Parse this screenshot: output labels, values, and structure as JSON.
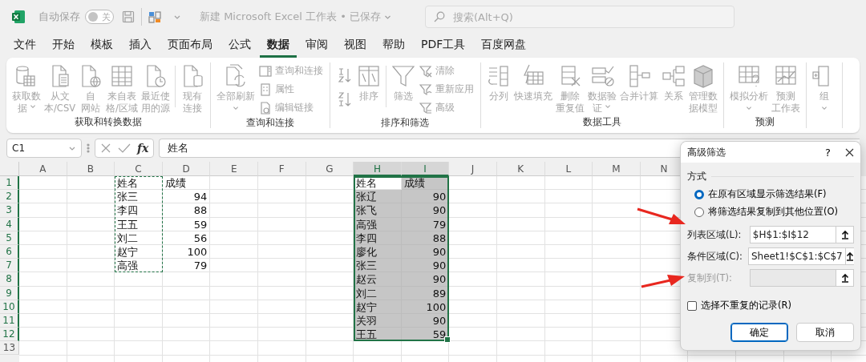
{
  "title_bar": {
    "autosave_label": "自动保存",
    "autosave": {
      "on": false,
      "label": "关"
    },
    "document_title": "新建 Microsoft Excel 工作表 • 已保存",
    "search_placeholder": "搜索(Alt+Q)"
  },
  "menu_tabs": [
    {
      "label": "文件",
      "selected": false
    },
    {
      "label": "开始",
      "selected": false
    },
    {
      "label": "模板",
      "selected": false
    },
    {
      "label": "插入",
      "selected": false
    },
    {
      "label": "页面布局",
      "selected": false
    },
    {
      "label": "公式",
      "selected": false
    },
    {
      "label": "数据",
      "selected": true
    },
    {
      "label": "审阅",
      "selected": false
    },
    {
      "label": "视图",
      "selected": false
    },
    {
      "label": "帮助",
      "selected": false
    },
    {
      "label": "PDF工具",
      "selected": false
    },
    {
      "label": "百度网盘",
      "selected": false
    }
  ],
  "ribbon": {
    "groups": [
      {
        "title": "获取和转换数据",
        "items": [
          {
            "kind": "large",
            "lines": [
              "获取数",
              "据"
            ],
            "dropdown": true
          },
          {
            "kind": "large",
            "lines": [
              "从文",
              "本/CSV"
            ],
            "dropdown": false
          },
          {
            "kind": "large",
            "lines": [
              "自",
              "网站"
            ],
            "dropdown": false
          },
          {
            "kind": "large",
            "lines": [
              "来自表",
              "格/区域"
            ],
            "dropdown": false
          },
          {
            "kind": "large",
            "lines": [
              "最近使",
              "用的源"
            ],
            "dropdown": false
          },
          {
            "kind": "separator"
          },
          {
            "kind": "large",
            "lines": [
              "现有",
              "连接"
            ],
            "dropdown": false
          }
        ]
      },
      {
        "title": "查询和连接",
        "items": [
          {
            "kind": "large",
            "lines": [
              "全部刷新"
            ],
            "dropdown": true
          },
          {
            "kind": "small_stack",
            "labels": [
              "查询和连接",
              "属性",
              "编辑链接"
            ]
          }
        ]
      },
      {
        "title": "排序和筛选",
        "items": [
          {
            "kind": "icon_stack"
          },
          {
            "kind": "large",
            "lines": [
              "排序"
            ],
            "dropdown": false
          },
          {
            "kind": "separator"
          },
          {
            "kind": "large",
            "lines": [
              "筛选"
            ],
            "dropdown": false
          },
          {
            "kind": "small_stack",
            "labels": [
              "清除",
              "重新应用",
              "高级"
            ]
          }
        ]
      },
      {
        "title": "数据工具",
        "items": [
          {
            "kind": "large",
            "lines": [
              "分列"
            ],
            "dropdown": false
          },
          {
            "kind": "large",
            "lines": [
              "快速填充"
            ],
            "dropdown": false
          },
          {
            "kind": "large",
            "lines": [
              "删除",
              "重复值"
            ],
            "dropdown": false
          },
          {
            "kind": "large",
            "lines": [
              "数据验",
              "证"
            ],
            "dropdown": true
          },
          {
            "kind": "large",
            "lines": [
              "合并计算"
            ],
            "dropdown": false
          },
          {
            "kind": "large",
            "lines": [
              "关系"
            ],
            "dropdown": false
          },
          {
            "kind": "large",
            "lines": [
              "管理数",
              "据模型"
            ],
            "dropdown": false
          }
        ]
      },
      {
        "title": "预测",
        "items": [
          {
            "kind": "large",
            "lines": [
              "模拟分析"
            ],
            "dropdown": true
          },
          {
            "kind": "large",
            "lines": [
              "预测",
              "工作表"
            ],
            "dropdown": false
          }
        ]
      },
      {
        "items": [
          {
            "kind": "large",
            "lines": [
              "组"
            ],
            "dropdown": true
          }
        ]
      }
    ]
  },
  "formula_bar": {
    "name_box": "C1",
    "function_label": "fx",
    "formula": "姓名"
  },
  "sheet": {
    "columns": [
      {
        "label": "A",
        "selected": false
      },
      {
        "label": "B",
        "selected": false
      },
      {
        "label": "C",
        "selected": false
      },
      {
        "label": "D",
        "selected": false
      },
      {
        "label": "E",
        "selected": false
      },
      {
        "label": "F",
        "selected": false
      },
      {
        "label": "G",
        "selected": false
      },
      {
        "label": "H",
        "selected": true
      },
      {
        "label": "I",
        "selected": true
      },
      {
        "label": "J",
        "selected": false
      },
      {
        "label": "K",
        "selected": false
      },
      {
        "label": "L",
        "selected": false
      },
      {
        "label": "M",
        "selected": false
      },
      {
        "label": "N",
        "selected": false
      }
    ],
    "rows": [
      {
        "label": "1",
        "selected": true
      },
      {
        "label": "2",
        "selected": true
      },
      {
        "label": "3",
        "selected": true
      },
      {
        "label": "4",
        "selected": true
      },
      {
        "label": "5",
        "selected": true
      },
      {
        "label": "6",
        "selected": true
      },
      {
        "label": "7",
        "selected": true
      },
      {
        "label": "8",
        "selected": true
      },
      {
        "label": "9",
        "selected": true
      },
      {
        "label": "10",
        "selected": true
      },
      {
        "label": "11",
        "selected": true
      },
      {
        "label": "12",
        "selected": true
      },
      {
        "label": "13",
        "selected": false
      }
    ],
    "criteria_range": {
      "marquee": true,
      "header": [
        "姓名",
        "成绩"
      ],
      "rows": [
        [
          "张三",
          "94"
        ],
        [
          "李四",
          "88"
        ],
        [
          "王五",
          "59"
        ],
        [
          "刘二",
          "56"
        ],
        [
          "赵宁",
          "100"
        ],
        [
          "高强",
          "79"
        ]
      ]
    },
    "list_range": {
      "selected": true,
      "header": [
        "姓名",
        "成绩"
      ],
      "rows": [
        [
          "张辽",
          "90"
        ],
        [
          "张飞",
          "90"
        ],
        [
          "高强",
          "79"
        ],
        [
          "李四",
          "88"
        ],
        [
          "廖化",
          "90"
        ],
        [
          "张三",
          "90"
        ],
        [
          "赵云",
          "90"
        ],
        [
          "刘二",
          "89"
        ],
        [
          "赵宁",
          "100"
        ],
        [
          "关羽",
          "90"
        ],
        [
          "王五",
          "59"
        ]
      ]
    }
  },
  "dialog": {
    "title": "高级筛选",
    "help": "?",
    "section": "方式",
    "options": [
      {
        "label": "在原有区域显示筛选结果(F)",
        "selected": true
      },
      {
        "label": "将筛选结果复制到其他位置(O)",
        "selected": false
      }
    ],
    "fields": [
      {
        "label": "列表区域(L):",
        "value": "$H$1:$I$12",
        "disabled": false
      },
      {
        "label": "条件区域(C):",
        "value": "Sheet1!$C$1:$C$7",
        "disabled": false
      },
      {
        "label": "复制到(T):",
        "disabled": true
      }
    ],
    "unique_records": {
      "label": "选择不重复的记录(R)",
      "checked": false
    },
    "buttons": [
      {
        "label": "确定",
        "default": true
      },
      {
        "label": "取消",
        "default": false
      }
    ]
  }
}
